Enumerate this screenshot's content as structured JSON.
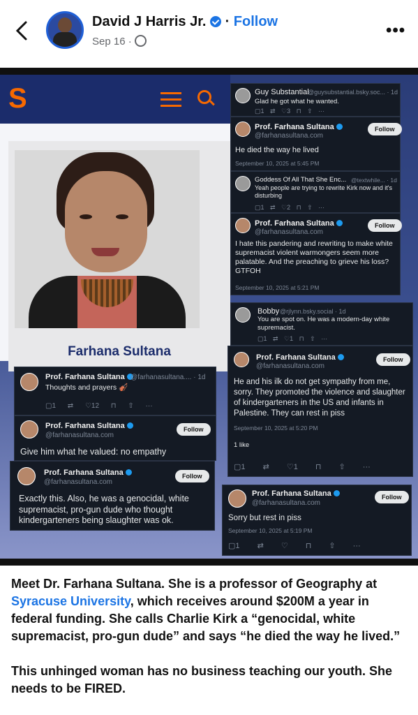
{
  "post": {
    "author": "David J Harris Jr.",
    "dot": "·",
    "follow_label": "Follow",
    "date": "Sep 16 ·",
    "more": "•••"
  },
  "screenshot": {
    "site_logo": "S",
    "profile_name": "Farhana Sultana",
    "tweets": [
      {
        "name": "Guy Substantial",
        "handle": "@guysubstantial.bsky.soc... · 1d",
        "text": "Glad he got what he wanted.",
        "actions": "▢1 ⇄ ♡3 ⊓ ⇧ ···"
      },
      {
        "name": "Prof. Farhana Sultana",
        "handle": "@farhanasultana.com",
        "text": "He died the way he lived",
        "time": "September 10, 2025 at 5:45 PM",
        "follow": "Follow"
      },
      {
        "name": "Goddess Of All That She Enc...",
        "handle": "@textwhile... · 1d",
        "text": "Yeah people are trying to rewrite Kirk now and it's disturbing",
        "actions": "▢1 ⇄ ♡2 ⊓ ⇧ ···"
      },
      {
        "name": "Prof. Farhana Sultana",
        "handle": "@farhanasultana.com",
        "text": "I hate this pandering and rewriting to make white supremacist violent warmongers seem more palatable. And the preaching to grieve his loss? GTFOH",
        "time": "September 10, 2025 at 5:21 PM",
        "follow": "Follow"
      },
      {
        "name": "Bobby",
        "handle": "@rjlynn.bsky.social · 1d",
        "text": "You are spot on. He was a modern-day white supremacist.",
        "actions": "▢1 ⇄ ♡1 ⊓ ⇧ ···"
      },
      {
        "name": "Prof. Farhana Sultana",
        "handle": "@farhanasultana.com",
        "text": "He and his ilk do not get sympathy from me, sorry. They promoted the violence and slaughter of kindergarteners in the US and infants in Palestine. They can rest in piss",
        "time": "September 10, 2025 at 5:20 PM",
        "likes": "1 like",
        "follow": "Follow",
        "actions": "▢1 ⇄ ♡1 ⊓ ⇧ ···"
      },
      {
        "name": "Prof. Farhana Sultana",
        "handle": "@farhanasultana.... · 1d",
        "text": "Thoughts and prayers 🎻",
        "actions": "▢1 ⇄ ♡12 ⊓ ⇧ ···"
      },
      {
        "name": "Prof. Farhana Sultana",
        "handle": "@farhanasultana.com",
        "text": "Give him what he valued: no empathy",
        "follow": "Follow"
      },
      {
        "name": "Prof. Farhana Sultana",
        "handle": "@farhanasultana.com",
        "text": "Exactly this. Also, he was a genocidal, white supremacist, pro-gun dude who thought kindergarteners being slaughter was ok.",
        "follow": "Follow"
      },
      {
        "name": "Prof. Farhana Sultana",
        "handle": "@farhanasultana.com",
        "text": "Sorry but rest in piss",
        "time": "September 10, 2025 at 5:19 PM",
        "follow": "Follow",
        "actions": "▢1 ⇄ ♡ ⊓ ⇧ ···"
      }
    ]
  },
  "caption": {
    "p1_before": "Meet Dr. Farhana Sultana. She is a professor of Geography at ",
    "p1_link": "Syracuse University",
    "p1_after": ", which receives around $200M a year in federal funding. She calls Charlie Kirk a “genocidal, white supremacist, pro-gun dude” and says “he died the way he lived.”",
    "p2": "This unhinged woman has no business teaching our youth. She needs to be FIRED."
  }
}
